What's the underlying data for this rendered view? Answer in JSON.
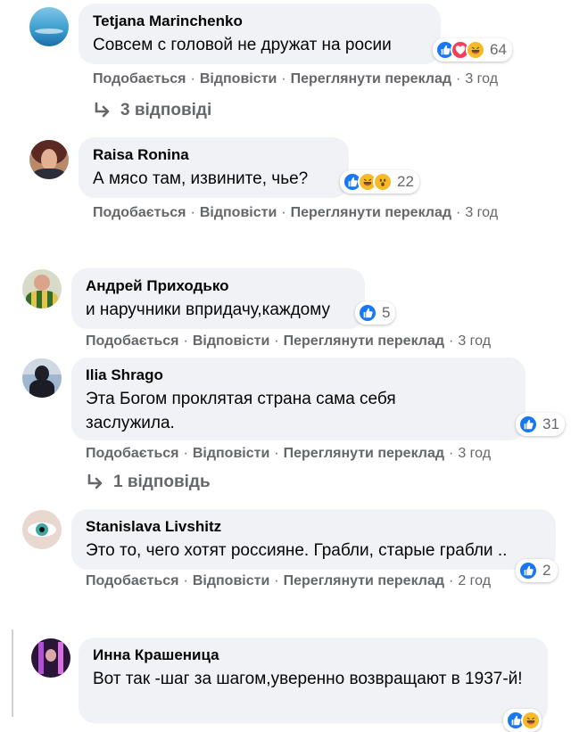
{
  "actions": {
    "like": "Подобається",
    "reply": "Відповісти",
    "translate": "Переглянути переклад",
    "separator": "·"
  },
  "comments": [
    {
      "author": "Tetjana Marinchenko",
      "text": "Совсем с головой не дружат на росии",
      "reactions": [
        "like-reaction-icon",
        "love-reaction-icon",
        "haha-reaction-icon"
      ],
      "reaction_count": "64",
      "time": "3 год",
      "replies_label": "3 відповіді"
    },
    {
      "author": "Raisa Ronina",
      "text": "А мясо там, извините, чье?",
      "reactions": [
        "like-reaction-icon",
        "haha-reaction-icon",
        "wow-reaction-icon"
      ],
      "reaction_count": "22",
      "time": "3 год"
    },
    {
      "author": "Андрей Приходько",
      "text": "и наручники впридачу,каждому",
      "reactions": [
        "like-reaction-icon"
      ],
      "reaction_count": "5",
      "time": "3 год"
    },
    {
      "author": "Ilia Shrago",
      "text": "Эта Богом проклятая страна сама себя заслужила.",
      "reactions": [
        "like-reaction-icon"
      ],
      "reaction_count": "31",
      "time": "3 год",
      "replies_label": "1 відповідь"
    },
    {
      "author": "Stanislava Livshitz",
      "text": "Это то, чего хотят россияне. Грабли, старые грабли ..",
      "reactions": [
        "like-reaction-icon"
      ],
      "reaction_count": "2",
      "time": "2 год"
    },
    {
      "author": "Инна Крашеница",
      "text": "Вот так -шаг за шагом,уверенно возвращают в 1937-й!",
      "reactions": [
        "like-reaction-icon",
        "haha-reaction-icon"
      ],
      "reaction_count": "",
      "time": ""
    }
  ],
  "colors": {
    "bubble_bg": "#f0f2f5",
    "meta_text": "#65676b",
    "like_blue": "#1877f2",
    "love_red": "#f33e58",
    "haha_yellow": "#f7b928"
  }
}
